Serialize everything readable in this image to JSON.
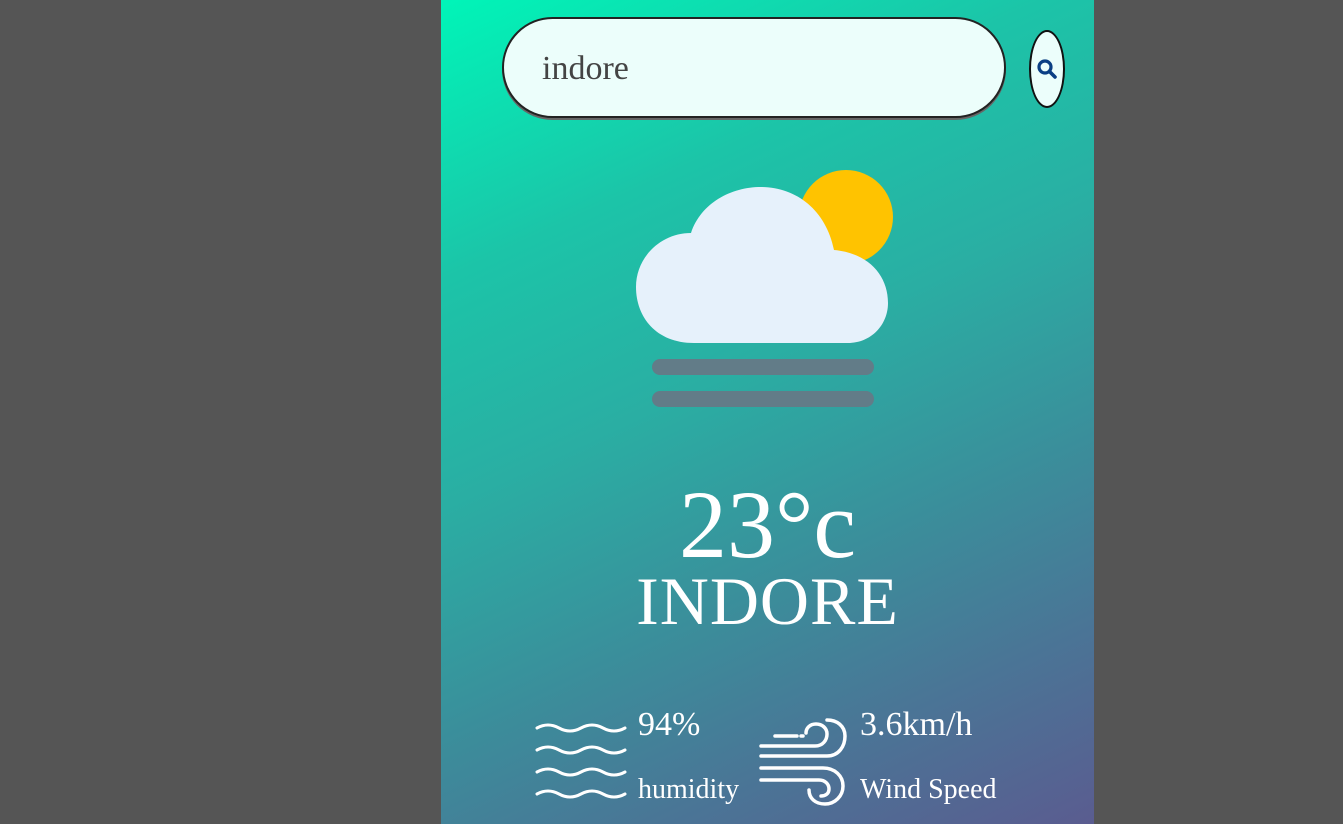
{
  "search": {
    "value": "indore"
  },
  "weather": {
    "icon": "cloud-sun-fog-icon",
    "temperature": "23°c",
    "city": "INDORE"
  },
  "details": {
    "humidity_value": "94%",
    "humidity_label": "humidity",
    "wind_value": "3.6km/h",
    "wind_label": "Wind Speed"
  },
  "colors": {
    "background": "#555555",
    "gradient_start": "#00f5b8",
    "gradient_end": "#5a5c90",
    "sun": "#ffc300",
    "cloud": "#e6f1fb",
    "fog": "#627c88"
  }
}
